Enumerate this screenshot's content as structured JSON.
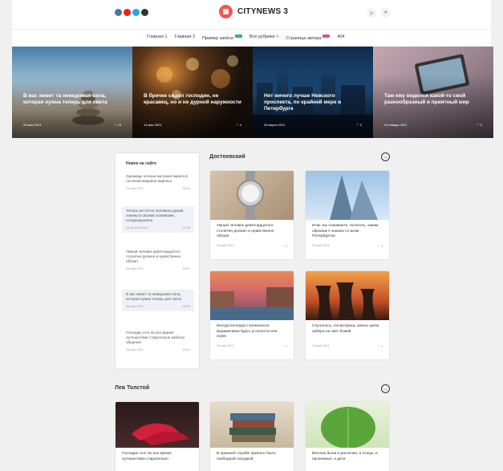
{
  "header": {
    "logo_text": "CITYNEWS 3",
    "socials": [
      {
        "name": "vk-icon",
        "color": "#4c75a3"
      },
      {
        "name": "youtube-icon",
        "color": "#e62117"
      },
      {
        "name": "telegram-icon",
        "color": "#2ca5e0"
      },
      {
        "name": "odnoklassniki-icon",
        "color": "#333333"
      }
    ],
    "icons": {
      "theme": "☼",
      "search": "⌕"
    }
  },
  "nav": {
    "items": [
      {
        "label": "Главная 1"
      },
      {
        "label": "Главная 2"
      },
      {
        "label": "Пример записи",
        "badge": "#3ab26a"
      },
      {
        "label": "Все рубрики ˅"
      },
      {
        "label": "Страница автора",
        "badge": "#e64b8a"
      },
      {
        "label": "404"
      }
    ]
  },
  "hero": [
    {
      "title": "В вас живет та неведомая сила, которая нужна теперь для света",
      "date": "26 мая 2021",
      "likes": "♡ 16"
    },
    {
      "title": "В бричке сидел господин, не красавец, но и не дурной наружности",
      "date": "14 мая 2021",
      "likes": "♡ 4"
    },
    {
      "title": "Нет ничего лучше Невского проспекта, по крайней мере в Петербурге",
      "date": "26 марта 2021",
      "likes": "♡ 2"
    },
    {
      "title": "Там ему виделся какой-то свой разнообразный и приятный мир",
      "date": "20 января 2021",
      "likes": "♡ 2"
    }
  ],
  "sidebar": {
    "title": "Новое на сайте",
    "items": [
      {
        "text": "Однажды осенью матушка варила в гостиной медовое варенье",
        "date": "14 мая 2021",
        "time": "18:15"
      },
      {
        "text": "Теперь же почта половина домов покинута своими хозяевами, полуразрушена",
        "date": "28 августа 2021",
        "time": "22:06"
      },
      {
        "text": "Умный человек девятнадцатого столетия должен и нравственно обязан",
        "date": "26 мая 2021",
        "time": "18:21"
      },
      {
        "text": "В вас живет та неведомая сила, которая нужна теперь для света",
        "date": "26 мая 2021",
        "time": "18:16"
      },
      {
        "text": "Господин этот во все время путешествия старательно избегал общения",
        "date": "26 мая 2021",
        "time": "18:21"
      }
    ]
  },
  "section1": {
    "title": "Достоевский",
    "arrow": "→",
    "cards": [
      {
        "title": "Умный человек девятнадцатого столетия должен и нравственно обязан",
        "date": "26 мая 2021",
        "likes": "♡ 5"
      },
      {
        "title": "Итак, вы понимаете, читатель, каким образом я знаком со всем Петербургом",
        "date": "25 мая 2021",
        "likes": "♡ 6"
      },
      {
        "title": "Иногда взглядого понкачался выражением будто усталости или скуки",
        "date": "16 мая 2021",
        "likes": "♡ 2"
      },
      {
        "title": "Случалось, посмотришь сквозь щели забора на свет божий",
        "date": "13 мая 2021",
        "likes": "♡ 4"
      }
    ]
  },
  "section2": {
    "title": "Лев Толстой",
    "arrow": "→",
    "cards": [
      {
        "title": "Господин этот во все время путешествия старательно"
      },
      {
        "title": "В прежней службе приятно было свободной походкой"
      },
      {
        "title": "Весною были и растения, и птицы, и насекомые, и дети"
      }
    ]
  }
}
